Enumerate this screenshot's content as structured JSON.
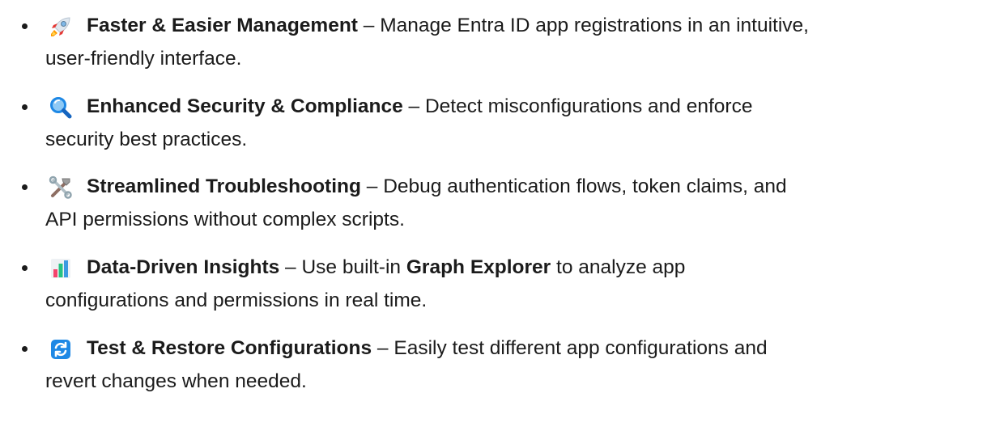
{
  "features": [
    {
      "icon": "rocket-icon",
      "title": "Faster & Easier Management",
      "line1_rest": " – Manage Entra ID app registrations in an intuitive,",
      "line2": "user-friendly interface."
    },
    {
      "icon": "magnifying-glass-icon",
      "title": "Enhanced Security & Compliance",
      "line1_rest": " – Detect misconfigurations and enforce",
      "line2": "security best practices."
    },
    {
      "icon": "tools-icon",
      "title": "Streamlined Troubleshooting",
      "line1_rest": " – Debug authentication flows, token claims, and",
      "line2": "API permissions without complex scripts."
    },
    {
      "icon": "bar-chart-icon",
      "title": "Data-Driven Insights",
      "line1_pre": " – Use built-in ",
      "line1_strong": "Graph Explorer",
      "line1_post": " to analyze app",
      "line2": "configurations and permissions in real time."
    },
    {
      "icon": "refresh-icon",
      "title": "Test & Restore Configurations",
      "line1_rest": " – Easily test different app configurations and",
      "line2": "revert changes when needed."
    }
  ],
  "colors": {
    "text": "#1b1b1b",
    "rocket": "#e8eef4",
    "magnifier": "#1e88e5",
    "chart_red": "#f4436c",
    "chart_green": "#26c281",
    "chart_blue": "#3b9ae1",
    "refresh_bg": "#1e88e5"
  }
}
